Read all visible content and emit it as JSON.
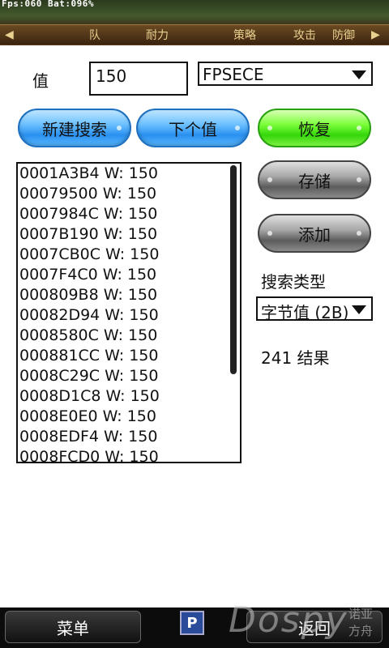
{
  "status": {
    "fps_text": "Fps:060  Bat:096%"
  },
  "game_menu": {
    "items": [
      "队",
      "耐力",
      "策略",
      "攻击",
      "防御"
    ],
    "left_arrow": "◀",
    "right_arrow": "▶"
  },
  "search": {
    "value_label": "值",
    "value_input": "150",
    "process_select": "FPSECE",
    "new_search_button": "新建搜索",
    "next_value_button": "下个值",
    "restore_button": "恢复",
    "store_button": "存储",
    "add_button": "添加",
    "search_type_label": "搜索类型",
    "search_type_select": "字节值 (2B)",
    "result_count": "241 结果"
  },
  "results": [
    "0001A3B4 W: 150",
    "00079500 W: 150",
    "0007984C W: 150",
    "0007B190 W: 150",
    "0007CB0C W: 150",
    "0007F4C0 W: 150",
    "000809B8 W: 150",
    "00082D94 W: 150",
    "0008580C W: 150",
    "000881CC W: 150",
    "0008C29C W: 150",
    "0008D1C8 W: 150",
    "0008E0E0 W: 150",
    "0008EDF4 W: 150",
    "0008FCD0 W: 150"
  ],
  "softkeys": {
    "left": "菜单",
    "right": "返回",
    "center_icon": "P"
  },
  "watermark": {
    "brand": "Dospy",
    "sub_line1": "诺亚",
    "sub_line2": "方舟"
  },
  "colors": {
    "accent_blue": "#2a90f0",
    "accent_green": "#34d60a",
    "button_gray": "#5c5c5c"
  }
}
